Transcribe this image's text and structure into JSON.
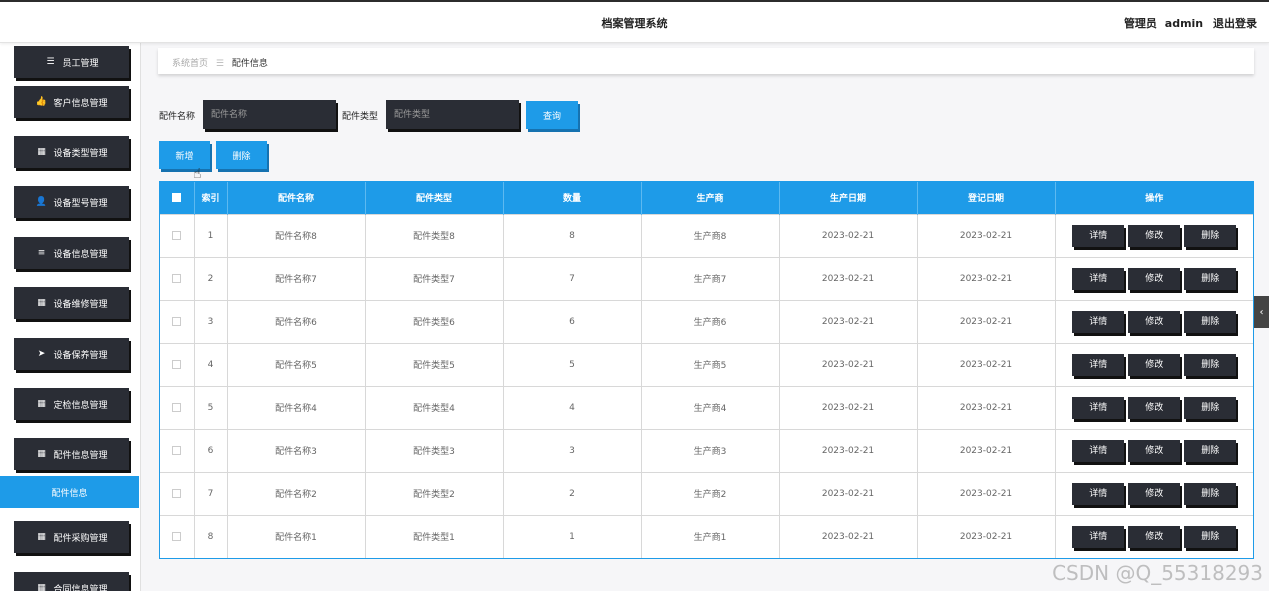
{
  "header": {
    "title": "档案管理系统",
    "role": "管理员",
    "username": "admin",
    "logout": "退出登录"
  },
  "sidebar": {
    "items": [
      {
        "label": "员工管理",
        "icon": "list-icon",
        "glyph": "☰"
      },
      {
        "label": "客户信息管理",
        "icon": "thumbs-up-icon",
        "glyph": "👍"
      },
      {
        "label": "设备类型管理",
        "icon": "grid-icon",
        "glyph": "▦"
      },
      {
        "label": "设备型号管理",
        "icon": "user-icon",
        "glyph": "👤"
      },
      {
        "label": "设备信息管理",
        "icon": "sliders-icon",
        "glyph": "≡"
      },
      {
        "label": "设备维修管理",
        "icon": "grid-icon",
        "glyph": "▦"
      },
      {
        "label": "设备保养管理",
        "icon": "send-icon",
        "glyph": "➤"
      },
      {
        "label": "定检信息管理",
        "icon": "grid-icon",
        "glyph": "▦"
      },
      {
        "label": "配件信息管理",
        "icon": "grid-icon",
        "glyph": "▦"
      },
      {
        "label": "配件采购管理",
        "icon": "table-icon",
        "glyph": "▦"
      },
      {
        "label": "合同信息管理",
        "icon": "grid-icon",
        "glyph": "▦"
      }
    ],
    "active_sub": "配件信息"
  },
  "breadcrumb": {
    "home": "系统首页",
    "sep": "☰",
    "current": "配件信息"
  },
  "search": {
    "name_label": "配件名称",
    "name_placeholder": "配件名称",
    "type_label": "配件类型",
    "type_placeholder": "配件类型",
    "query_button": "查询"
  },
  "toolbar": {
    "add_button": "新增",
    "delete_button": "删除"
  },
  "table": {
    "headers": [
      "索引",
      "配件名称",
      "配件类型",
      "数量",
      "生产商",
      "生产日期",
      "登记日期",
      "操作"
    ],
    "actions": {
      "detail": "详情",
      "edit": "修改",
      "delete": "删除"
    },
    "rows": [
      {
        "index": "1",
        "name": "配件名称8",
        "type": "配件类型8",
        "qty": "8",
        "maker": "生产商8",
        "prod_date": "2023-02-21",
        "reg_date": "2023-02-21"
      },
      {
        "index": "2",
        "name": "配件名称7",
        "type": "配件类型7",
        "qty": "7",
        "maker": "生产商7",
        "prod_date": "2023-02-21",
        "reg_date": "2023-02-21"
      },
      {
        "index": "3",
        "name": "配件名称6",
        "type": "配件类型6",
        "qty": "6",
        "maker": "生产商6",
        "prod_date": "2023-02-21",
        "reg_date": "2023-02-21"
      },
      {
        "index": "4",
        "name": "配件名称5",
        "type": "配件类型5",
        "qty": "5",
        "maker": "生产商5",
        "prod_date": "2023-02-21",
        "reg_date": "2023-02-21"
      },
      {
        "index": "5",
        "name": "配件名称4",
        "type": "配件类型4",
        "qty": "4",
        "maker": "生产商4",
        "prod_date": "2023-02-21",
        "reg_date": "2023-02-21"
      },
      {
        "index": "6",
        "name": "配件名称3",
        "type": "配件类型3",
        "qty": "3",
        "maker": "生产商3",
        "prod_date": "2023-02-21",
        "reg_date": "2023-02-21"
      },
      {
        "index": "7",
        "name": "配件名称2",
        "type": "配件类型2",
        "qty": "2",
        "maker": "生产商2",
        "prod_date": "2023-02-21",
        "reg_date": "2023-02-21"
      },
      {
        "index": "8",
        "name": "配件名称1",
        "type": "配件类型1",
        "qty": "1",
        "maker": "生产商1",
        "prod_date": "2023-02-21",
        "reg_date": "2023-02-21"
      }
    ]
  },
  "side_tab": "‹",
  "watermark": "CSDN @Q_55318293",
  "colors": {
    "accent": "#1e9be8",
    "dark_button": "#2a2d35"
  }
}
